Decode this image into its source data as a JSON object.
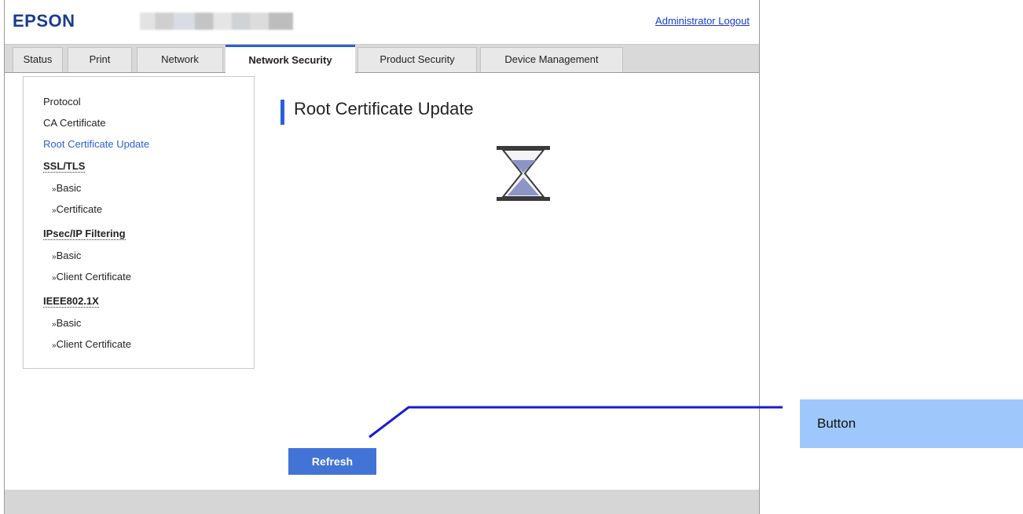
{
  "header": {
    "logo": "EPSON",
    "logout_label": "Administrator Logout"
  },
  "tabs": [
    {
      "label": "Status"
    },
    {
      "label": "Print"
    },
    {
      "label": "Network"
    },
    {
      "label": "Network Security",
      "active": true
    },
    {
      "label": "Product Security"
    },
    {
      "label": "Device Management"
    }
  ],
  "sidebar": {
    "items": [
      {
        "label": "Protocol"
      },
      {
        "label": "CA Certificate"
      },
      {
        "label": "Root Certificate Update",
        "active": true
      },
      {
        "label": "SSL/TLS"
      },
      {
        "label": "Basic"
      },
      {
        "label": "Certificate"
      },
      {
        "label": "IPsec/IP Filtering"
      },
      {
        "label": "Basic"
      },
      {
        "label": "Client Certificate"
      },
      {
        "label": "IEEE802.1X"
      },
      {
        "label": "Basic"
      },
      {
        "label": "Client Certificate"
      }
    ]
  },
  "main": {
    "title": "Root Certificate Update",
    "status_icon": "hourglass-icon",
    "refresh_label": "Refresh"
  },
  "annotation": {
    "label": "Button"
  },
  "colors": {
    "accent": "#2b5fd9",
    "button": "#4273d6",
    "callout": "#9ec8fb",
    "logo": "#1a3c8f"
  }
}
